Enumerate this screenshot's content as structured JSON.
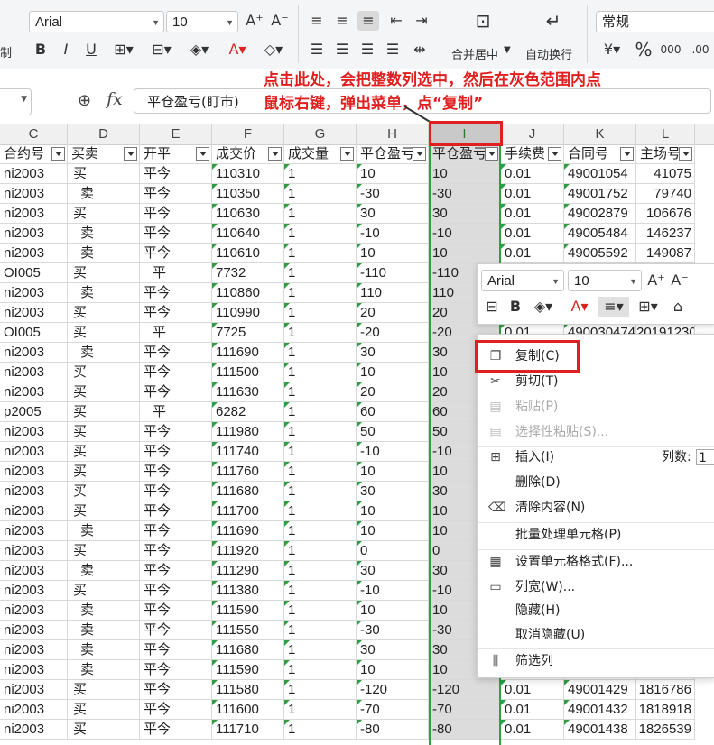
{
  "ribbon": {
    "font_name": "Arial",
    "font_size": "10",
    "number_format": "常规",
    "merge_label": "合并居中",
    "wrap_label": "自动换行",
    "left_partial": "制",
    "icons": [
      "grow-font-icon",
      "shrink-font-icon",
      "bold-icon",
      "italic-icon",
      "underline-icon",
      "border-icon",
      "fill-color-icon",
      "font-color-icon",
      "eraser-icon",
      "align-top-icon",
      "align-middle-icon",
      "align-bottom-icon",
      "indent-icon",
      "currency-icon",
      "percent-icon",
      "thousands-icon",
      "decimal-icon"
    ]
  },
  "formula_bar": {
    "fx": "fx",
    "value": "平仓盈亏(盯市)"
  },
  "annotation": {
    "line1": "点击此处，会把整数列选中，然后在灰色范围内点",
    "line2": "鼠标右键，弹出菜单，点“复制”",
    "color": "#e02020"
  },
  "columns": [
    "C",
    "D",
    "E",
    "F",
    "G",
    "H",
    "I",
    "J",
    "K",
    "L",
    ""
  ],
  "headers": [
    "合约号",
    "买卖",
    "开平",
    "成交价",
    "成交量",
    "平仓盈亏",
    "平仓盈亏",
    "手续费",
    "合同号",
    "主场号"
  ],
  "rows": [
    [
      "ni2003",
      "买",
      "平今",
      "110310",
      "1",
      "10",
      "10",
      "0.01",
      "49001054",
      "41075"
    ],
    [
      "ni2003",
      "卖",
      "平今",
      "110350",
      "1",
      "-30",
      "-30",
      "0.01",
      "49001752",
      "79740"
    ],
    [
      "ni2003",
      "买",
      "平今",
      "110630",
      "1",
      "30",
      "30",
      "0.01",
      "49002879",
      "106676"
    ],
    [
      "ni2003",
      "卖",
      "平今",
      "110640",
      "1",
      "-10",
      "-10",
      "0.01",
      "49005484",
      "146237"
    ],
    [
      "ni2003",
      "卖",
      "平今",
      "110610",
      "1",
      "10",
      "10",
      "0.01",
      "49005592",
      "149087"
    ],
    [
      "OI005",
      "买",
      "平",
      "7732",
      "1",
      "-110",
      "-110",
      "",
      "",
      ""
    ],
    [
      "ni2003",
      "卖",
      "平今",
      "110860",
      "1",
      "110",
      "110",
      "",
      "",
      ""
    ],
    [
      "ni2003",
      "买",
      "平今",
      "110990",
      "1",
      "20",
      "20",
      "",
      "",
      ""
    ],
    [
      "OI005",
      "买",
      "平",
      "7725",
      "1",
      "-20",
      "-20",
      "0.01",
      "490030474",
      "201912300"
    ],
    [
      "ni2003",
      "卖",
      "平今",
      "111690",
      "1",
      "30",
      "30",
      "",
      "",
      ""
    ],
    [
      "ni2003",
      "买",
      "平今",
      "111500",
      "1",
      "10",
      "10",
      "",
      "",
      ""
    ],
    [
      "ni2003",
      "买",
      "平今",
      "111630",
      "1",
      "20",
      "20",
      "",
      "",
      ""
    ],
    [
      "p2005",
      "买",
      "平",
      "6282",
      "1",
      "60",
      "60",
      "",
      "",
      ""
    ],
    [
      "ni2003",
      "买",
      "平今",
      "111980",
      "1",
      "50",
      "50",
      "",
      "",
      ""
    ],
    [
      "ni2003",
      "买",
      "平今",
      "111740",
      "1",
      "-10",
      "-10",
      "",
      "",
      ""
    ],
    [
      "ni2003",
      "买",
      "平今",
      "111760",
      "1",
      "10",
      "10",
      "",
      "",
      ""
    ],
    [
      "ni2003",
      "买",
      "平今",
      "111680",
      "1",
      "30",
      "30",
      "",
      "",
      ""
    ],
    [
      "ni2003",
      "买",
      "平今",
      "111700",
      "1",
      "10",
      "10",
      "",
      "",
      ""
    ],
    [
      "ni2003",
      "卖",
      "平今",
      "111690",
      "1",
      "10",
      "10",
      "",
      "",
      ""
    ],
    [
      "ni2003",
      "买",
      "平今",
      "111920",
      "1",
      "0",
      "0",
      "",
      "",
      ""
    ],
    [
      "ni2003",
      "卖",
      "平今",
      "111290",
      "1",
      "30",
      "30",
      "",
      "",
      ""
    ],
    [
      "ni2003",
      "买",
      "平今",
      "111380",
      "1",
      "-10",
      "-10",
      "",
      "",
      ""
    ],
    [
      "ni2003",
      "卖",
      "平今",
      "111590",
      "1",
      "10",
      "10",
      "",
      "",
      ""
    ],
    [
      "ni2003",
      "卖",
      "平今",
      "111550",
      "1",
      "-30",
      "-30",
      "",
      "",
      ""
    ],
    [
      "ni2003",
      "卖",
      "平今",
      "111680",
      "1",
      "30",
      "30",
      "",
      "",
      ""
    ],
    [
      "ni2003",
      "卖",
      "平今",
      "111590",
      "1",
      "10",
      "10",
      "",
      "",
      ""
    ],
    [
      "ni2003",
      "买",
      "平今",
      "111580",
      "1",
      "-120",
      "-120",
      "0.01",
      "49001429",
      "1816786"
    ],
    [
      "ni2003",
      "买",
      "平今",
      "111600",
      "1",
      "-70",
      "-70",
      "0.01",
      "49001432",
      "1818918"
    ],
    [
      "ni2003",
      "买",
      "平今",
      "111710",
      "1",
      "-80",
      "-80",
      "0.01",
      "49001438",
      "1826539"
    ]
  ],
  "mini_toolbar": {
    "font_name": "Arial",
    "font_size": "10"
  },
  "menu": {
    "copy": "复制(C)",
    "cut": "剪切(T)",
    "paste": "粘贴(P)",
    "paste_special": "选择性粘贴(S)...",
    "insert": "插入(I)",
    "insert_count_label": "列数:",
    "insert_count_value": "1",
    "delete": "删除(D)",
    "clear": "清除内容(N)",
    "batch": "批量处理单元格(P)",
    "format": "设置单元格格式(F)...",
    "width": "列宽(W)...",
    "hide": "隐藏(H)",
    "unhide": "取消隐藏(U)",
    "filter": "筛选列"
  }
}
